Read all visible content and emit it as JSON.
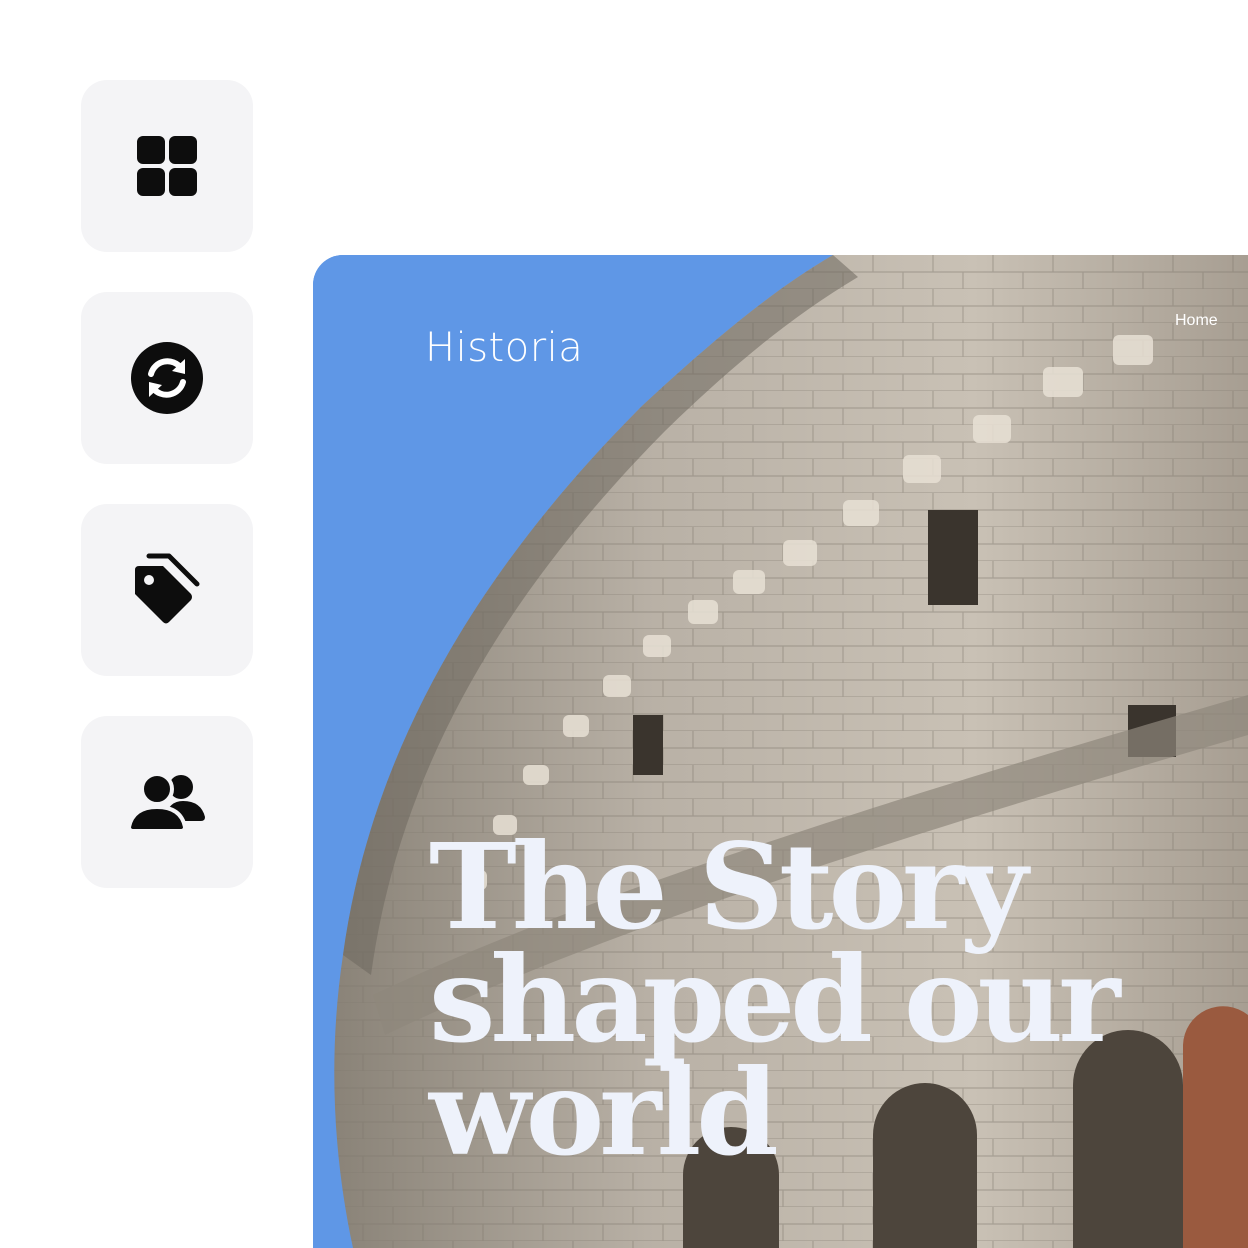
{
  "sidebar": {
    "items": [
      {
        "name": "grid",
        "icon": "grid-icon"
      },
      {
        "name": "sync",
        "icon": "sync-icon"
      },
      {
        "name": "tags",
        "icon": "tags-icon"
      },
      {
        "name": "users",
        "icon": "users-icon"
      }
    ]
  },
  "hero": {
    "brand": "Historia",
    "nav_home": "Home",
    "headline": "The Story shaped our world",
    "image": "colosseum-photo",
    "colors": {
      "sky": "#5f97e6",
      "stone": "#b3aaa0",
      "headline": "#eef2fb"
    }
  }
}
